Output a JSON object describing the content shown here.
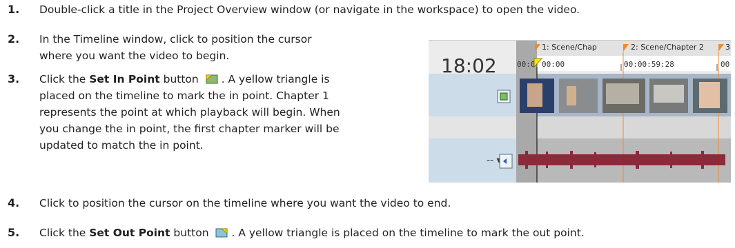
{
  "steps": [
    {
      "number": "1.",
      "text": "Double-click a title in the Project Overview window (or navigate in the workspace) to open the video."
    },
    {
      "number": "2.",
      "lines": [
        "In the Timeline window, click to position the cursor",
        "where you want the video to begin."
      ]
    },
    {
      "number": "3.",
      "pre": "Click the ",
      "bold": "Set In Point",
      "mid": " button ",
      "post": ". A yellow triangle is",
      "lines": [
        "placed on the timeline to mark the in point. Chapter 1",
        "represents the point at which playback will begin. When",
        "you change the in point, the first chapter marker will be",
        "updated to match the in point."
      ]
    },
    {
      "number": "4.",
      "text": "Click to position the cursor on the timeline where you want the video to end."
    },
    {
      "number": "5.",
      "pre": "Click the ",
      "bold": "Set Out Point",
      "mid": " button ",
      "post": ". A yellow triangle is placed on the timeline to mark the out point."
    }
  ],
  "icons": {
    "set_in_point": "set-in-point-icon",
    "set_out_point": "set-out-point-icon"
  },
  "timeline": {
    "time": "18:02",
    "chapter1": "1: Scene/Chap",
    "chapter2": "2: Scene/Chapter 2",
    "chapter3": "3",
    "tc_a": "00:0",
    "tc_b": "00:00",
    "tc_c": "00:00:59:28",
    "tc_d": "00",
    "audio_dropdown": "-- ▾",
    "colors": {
      "chapter_marker": "#f08a2c",
      "in_point": "#ffe600",
      "waveform": "#8b2a3a"
    }
  }
}
